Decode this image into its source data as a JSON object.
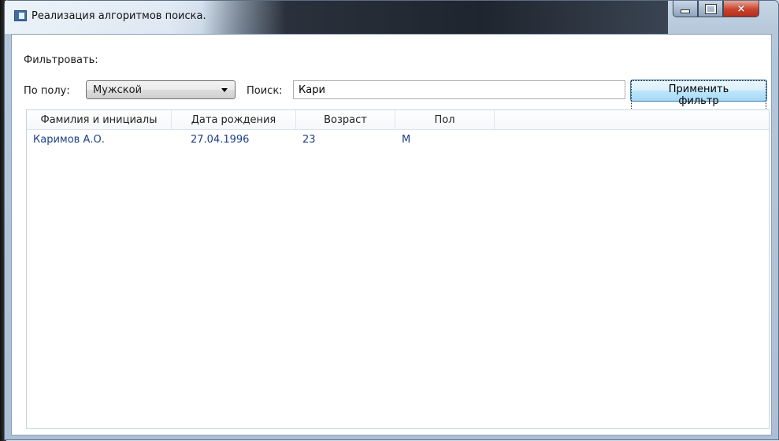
{
  "window": {
    "title": "Реализация алгоритмов поиска.",
    "buttons": {
      "minimize": "minimize-icon",
      "maximize": "maximize-icon",
      "close": "×"
    }
  },
  "filter": {
    "heading": "Фильтровать:",
    "gender_label": "По полу:",
    "gender_value": "Мужской",
    "search_label": "Поиск:",
    "search_value": "Кари",
    "apply_label": "Применить фильтр"
  },
  "table": {
    "columns": [
      "Фамилия и инициалы",
      "Дата рождения",
      "Возраст",
      "Пол"
    ],
    "rows": [
      [
        "Каримов А.О.",
        "27.04.1996",
        "23",
        "М"
      ]
    ]
  },
  "colors": {
    "row_text": "#1d3f86",
    "close_button": "#c8432e"
  }
}
